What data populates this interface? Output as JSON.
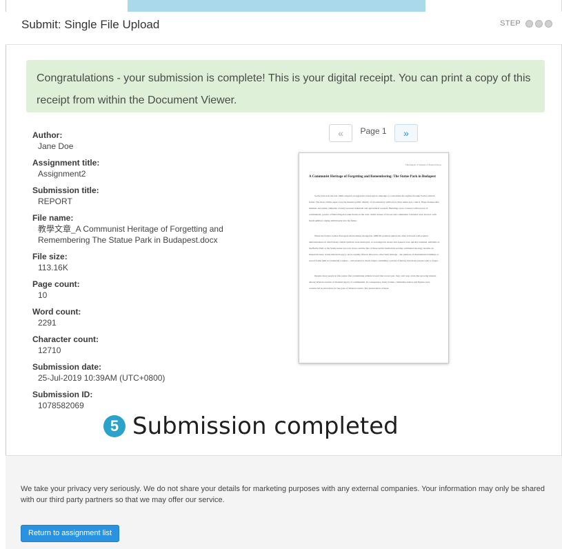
{
  "header": {
    "title": "Submit: Single File Upload",
    "step_label": "STEP"
  },
  "alert": {
    "message": "Congratulations - your submission is complete! This is your digital receipt. You can print a copy of this receipt from within the Document Viewer."
  },
  "receipt": {
    "fields": [
      {
        "label": "Author:",
        "value": "Jane Doe"
      },
      {
        "label": "Assignment title:",
        "value": "Assignment2"
      },
      {
        "label": "Submission title:",
        "value": "REPORT"
      },
      {
        "label": "File name:",
        "value": "教學文章_A Communist Heritage of Forgetting and Remembering The Statue Park in Budapest.docx"
      },
      {
        "label": "File size:",
        "value": "113.16K"
      },
      {
        "label": "Page count:",
        "value": "10"
      },
      {
        "label": "Word count:",
        "value": "2291"
      },
      {
        "label": "Character count:",
        "value": "12710"
      },
      {
        "label": "Submission date:",
        "value": "25-Jul-2019 10:39AM (UTC+0800)"
      },
      {
        "label": "Submission ID:",
        "value": "1078582069"
      }
    ]
  },
  "viewer": {
    "prev_label": "«",
    "page_label": "Page 1",
    "next_label": "»",
    "doc_header": "Final Report of Students of Eastern Europe",
    "doc_title": "A Communist Heritage of Forgetting and Remembering: The Statue Park in Budapest",
    "doc_paragraphs": [
      "Soviet Union in the late 1940s adopted an aggressive ideological campaign to consolidate the regime through Soviet cultural forms. The most visible aspect was the massive public display of revolutionary symbols in cities under new control. Huge features like hammer and sickle, emblems of unity between industrial and agricultural workers. Buildings were crowned with red star of communism, posters of Marx-Engels-Lenin-Stalin on the wall, whilst statues of heroes and communist comrades were erected, with heads uplifted, staring ambitiously into the future.",
      "When the former Central European dictatorships changed in 1989-90, political upheavals often followed with popular demonstrations in which many visible symbols were destroyed, or rearranged in streets and squares were quickly renamed, emblems as the Berlin Wall or the Stalin statue was torn down, and the fate of these public memorials serving communal ideology became an important issue. Some material legacy can be rapidly effaced. However, other built heritage – the plethora of monumental buildings or sacred forms built for industrial workers – will persist for much longer, reminding a period of history that many people want to forget.",
      "Despite most people in this region that condemning attitude toward that recent past, they can't stop a tide like growing interest among Western tourists of material legacy of communism. In consequence, many former communist statues and figures were constructed as attractions for the gaze of Western tourist. The preservation of these"
    ]
  },
  "overlay": {
    "number": "5",
    "caption": "Submission completed"
  },
  "footer": {
    "privacy_text": "We take your privacy very seriously. We do not share your details for marketing purposes with any external companies. Your information may only be shared with our third party partners so that we may offer our service.",
    "return_button": "Return to assignment list"
  },
  "colors": {
    "alert_bg": "#def0d8",
    "accent_blue": "#2a93e1",
    "badge_teal": "#2aa2c9",
    "top_tab": "#a9d9ea"
  }
}
